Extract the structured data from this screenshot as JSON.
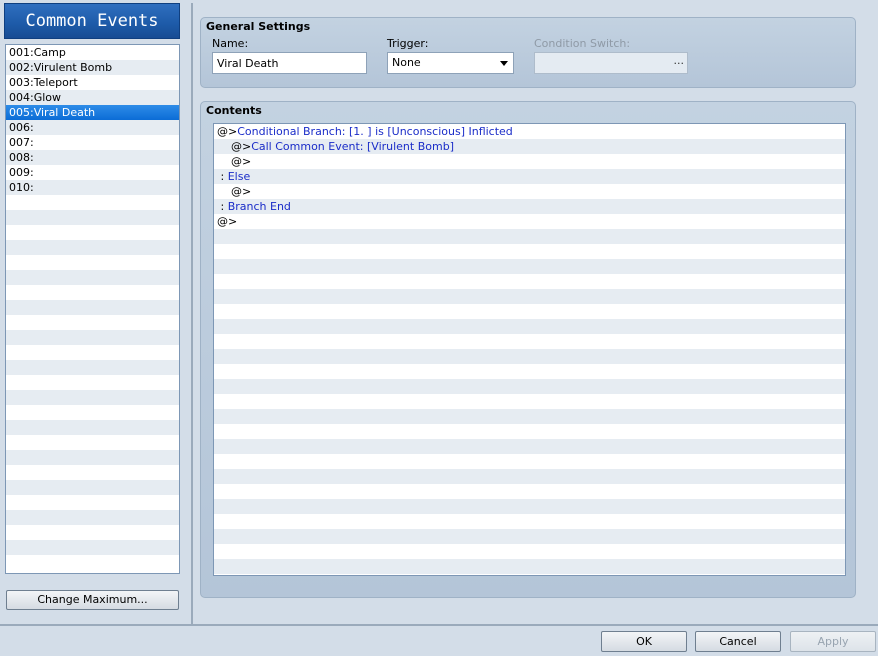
{
  "window_title": "Common Events",
  "events": [
    {
      "label": "001:Camp"
    },
    {
      "label": "002:Virulent Bomb"
    },
    {
      "label": "003:Teleport"
    },
    {
      "label": "004:Glow"
    },
    {
      "label": "005:Viral Death",
      "selected": true
    },
    {
      "label": "006:"
    },
    {
      "label": "007:"
    },
    {
      "label": "008:"
    },
    {
      "label": "009:"
    },
    {
      "label": "010:"
    }
  ],
  "change_max_label": "Change Maximum...",
  "general": {
    "title": "General Settings",
    "name_label": "Name:",
    "name_value": "Viral Death",
    "trigger_label": "Trigger:",
    "trigger_value": "None",
    "switch_label": "Condition Switch:",
    "switch_button": "..."
  },
  "contents": {
    "title": "Contents",
    "commands": [
      {
        "prefix": "@>",
        "text": "Conditional Branch: [1. ] is [Unconscious] Inflicted"
      },
      {
        "prefix": "    @>",
        "text": "Call Common Event: [Virulent Bomb]"
      },
      {
        "prefix": "    @>",
        "text": ""
      },
      {
        "prefix": " : ",
        "text": "Else"
      },
      {
        "prefix": "    @>",
        "text": ""
      },
      {
        "prefix": " : ",
        "text": "Branch End"
      },
      {
        "prefix": "@>",
        "text": ""
      }
    ]
  },
  "buttons": {
    "ok": "OK",
    "cancel": "Cancel",
    "apply": "Apply"
  }
}
